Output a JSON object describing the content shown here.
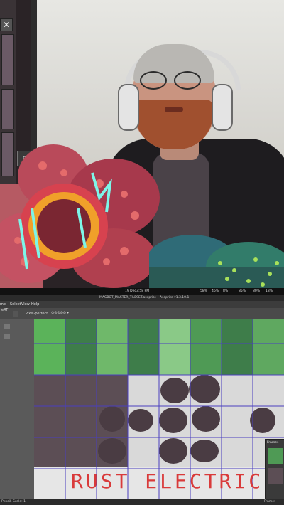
{
  "stream": {
    "close_icon": "✕",
    "tool_icon": "⊏"
  },
  "taskbar": {
    "date": "19 Dec",
    "time": "3:58 PM",
    "tray_a": "58%",
    "tray_b": "46%",
    "tray_c": "8%",
    "tray_d": "85%",
    "tray_e": "80%",
    "tray_f": "18%"
  },
  "window": {
    "title": "MAGBOT_MASTER_TILESET.aseprite – Aseprite v1.3.10.1"
  },
  "menu": {
    "items": [
      "me",
      "Select",
      "View",
      "Help"
    ]
  },
  "subbar": {
    "left": "eRT",
    "mode": "Pixel-perfect"
  },
  "editor": {
    "canvas_text": "RUST  ELECTRIC",
    "frames_label": "Frames",
    "status_left": "Pencil, Scale: 1",
    "status_right": "Frame:"
  },
  "colors": {
    "grid": "#4a3fbf",
    "canvas_text": "#d93a3a",
    "accent_green": "#3f8f3a"
  }
}
